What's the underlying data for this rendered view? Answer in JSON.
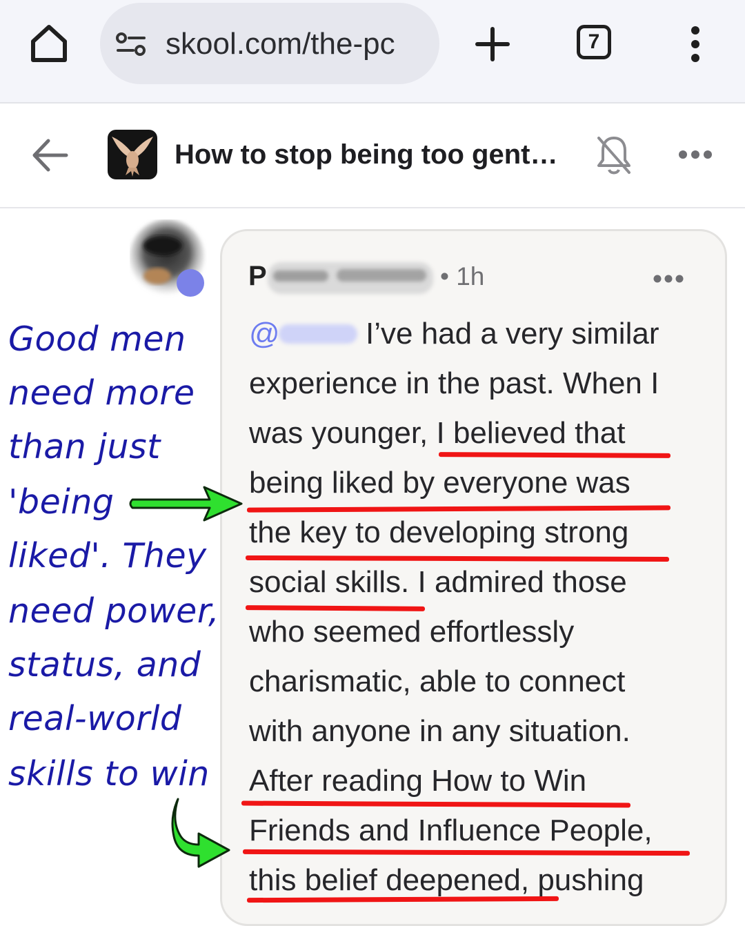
{
  "browser": {
    "url": "skool.com/the-pc",
    "tab_count": "7",
    "icons": [
      "home-icon",
      "site-settings-icon",
      "new-tab-icon",
      "tabs-icon",
      "menu-icon"
    ]
  },
  "header": {
    "title": "How to stop being too gentl…",
    "icons": [
      "back-arrow-icon",
      "group-logo",
      "bell-off-icon",
      "more-options-icon"
    ]
  },
  "comment": {
    "author_initial": "P",
    "timestamp": "• 1h",
    "mention_prefix": "@",
    "lines": [
      "I’ve had a very similar",
      "experience in the past. When I",
      "was younger, I believed that",
      "being liked by everyone was",
      "the key to developing strong",
      "social skills. I admired those",
      "who seemed effortlessly",
      "charismatic, able to connect",
      "with anyone in any situation.",
      "After reading How to Win",
      "Friends and Influence People,",
      "this belief deepened, pushing"
    ]
  },
  "annotation": {
    "lines": [
      "Good men",
      "need more",
      "than just",
      "'being",
      "liked'. They",
      "need power,",
      "status, and",
      "real-world",
      "skills to win"
    ]
  },
  "colors": {
    "annotation_text": "#1a1aa6",
    "underline": "#f01515",
    "arrow": "#2fe02f",
    "mention": "#6d7cf0"
  }
}
